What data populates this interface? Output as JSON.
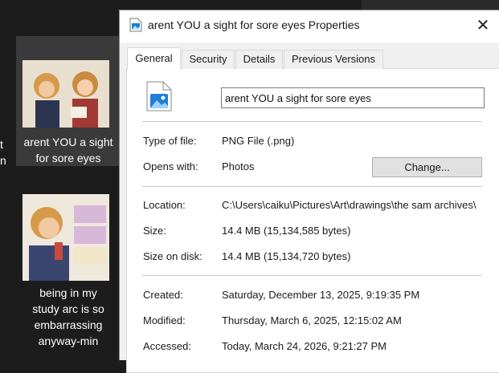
{
  "explorer": {
    "clipped_lines": [
      "t",
      "n"
    ],
    "files": [
      {
        "name_lines": [
          "arent YOU a sight",
          "for sore eyes"
        ]
      },
      {
        "name_lines": [
          "being in my",
          "study arc is so",
          "embarrassing",
          "anyway-min"
        ]
      }
    ]
  },
  "dialog": {
    "title": "arent YOU a sight for sore eyes Properties",
    "close_glyph": "✕",
    "tabs": [
      "General",
      "Security",
      "Details",
      "Previous Versions"
    ],
    "active_tab": "General",
    "file_name": "arent YOU a sight for sore eyes",
    "type_of_file_label": "Type of file:",
    "type_of_file": "PNG File (.png)",
    "opens_with_label": "Opens with:",
    "opens_with": "Photos",
    "change_button": "Change...",
    "location_label": "Location:",
    "location": "C:\\Users\\caiku\\Pictures\\Art\\drawings\\the sam archives\\",
    "size_label": "Size:",
    "size": "14.4 MB (15,134,585 bytes)",
    "size_on_disk_label": "Size on disk:",
    "size_on_disk": "14.4 MB (15,134,720 bytes)",
    "created_label": "Created:",
    "created": "Saturday, December 13, 2025, 9:19:35 PM",
    "modified_label": "Modified:",
    "modified": "Thursday, March 6, 2025, 12:15:02 AM",
    "accessed_label": "Accessed:",
    "accessed": "Today, March 24, 2026, 9:21:27 PM"
  },
  "colors": {
    "explorer_bg": "#1c1c1c",
    "selected_tile": "#3a3a3a",
    "dialog_bg": "#f0f0f0",
    "icon_blue": "#1f7fd6"
  }
}
